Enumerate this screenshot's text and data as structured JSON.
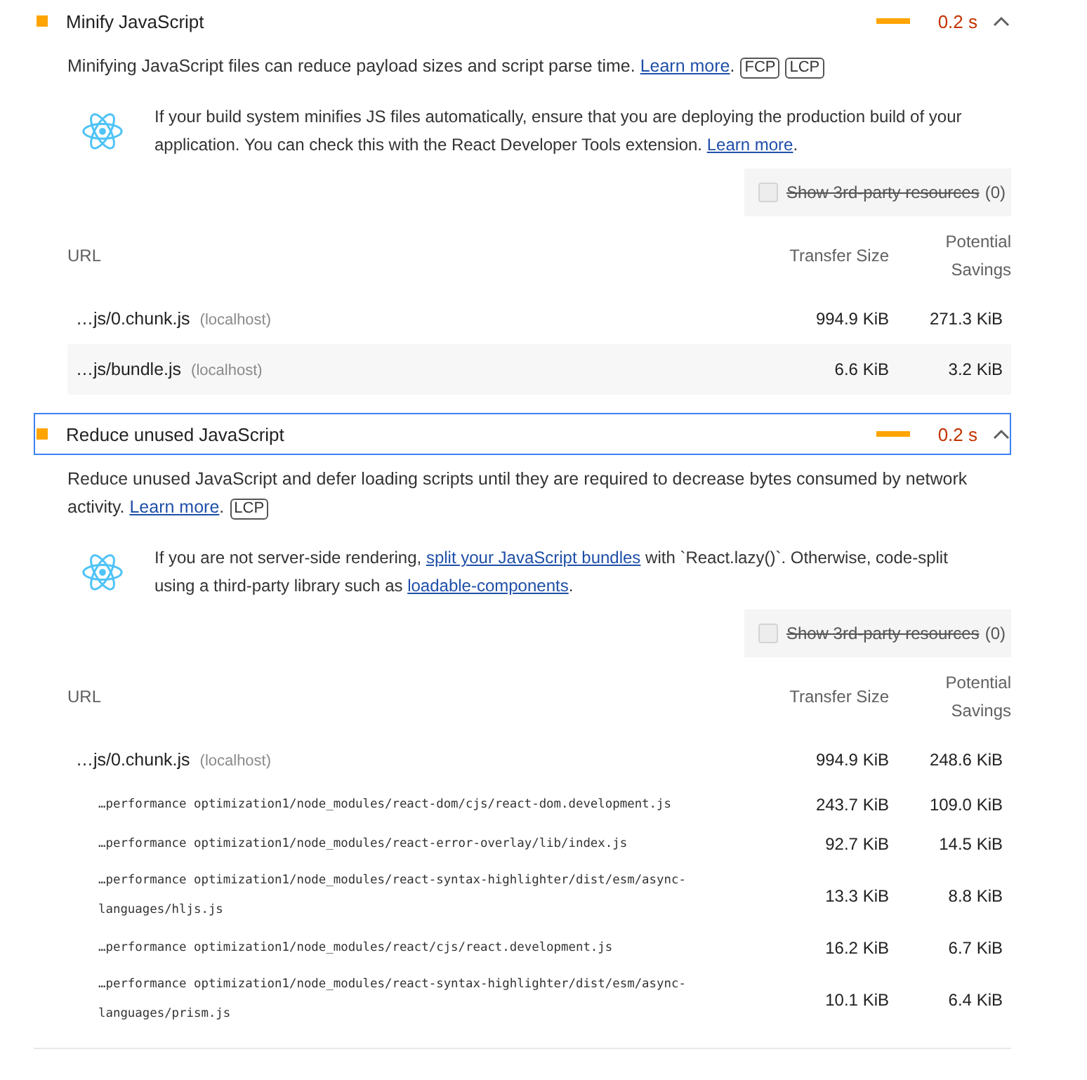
{
  "audits": [
    {
      "kind": "average",
      "title": "Minify JavaScript",
      "display_value": "0.2 s",
      "expanded": true,
      "focused": false,
      "description": [
        {
          "kind": "text",
          "text": "Minifying JavaScript files can reduce payload sizes and script parse time. "
        },
        {
          "kind": "link",
          "text": "Learn more"
        },
        {
          "kind": "text",
          "text": "."
        }
      ],
      "metrics": [
        "FCP",
        "LCP"
      ],
      "stack_pack": [
        {
          "kind": "text",
          "text": "If your build system minifies JS files automatically, ensure that you are deploying the production build of your application. You can check this with the React Developer Tools extension. "
        },
        {
          "kind": "link",
          "text": "Learn more"
        },
        {
          "kind": "text",
          "text": "."
        }
      ],
      "third_party_filter": {
        "label": "Show 3rd-party resources",
        "count": "(0)",
        "checked": false,
        "disabled": true
      },
      "table": {
        "columns": [
          "URL",
          "Transfer Size",
          "Potential Savings"
        ],
        "rows": [
          {
            "url": "…js/0.chunk.js",
            "host": "(localhost)",
            "transfer_size": "994.9 KiB",
            "savings": "271.3 KiB"
          },
          {
            "url": "…js/bundle.js",
            "host": "(localhost)",
            "transfer_size": "6.6 KiB",
            "savings": "3.2 KiB"
          }
        ]
      }
    },
    {
      "kind": "average",
      "title": "Reduce unused JavaScript",
      "display_value": "0.2 s",
      "expanded": true,
      "focused": true,
      "description": [
        {
          "kind": "text",
          "text": "Reduce unused JavaScript and defer loading scripts until they are required to decrease bytes consumed by network activity. "
        },
        {
          "kind": "link",
          "text": "Learn more"
        },
        {
          "kind": "text",
          "text": "."
        }
      ],
      "metrics": [
        "LCP"
      ],
      "stack_pack": [
        {
          "kind": "text",
          "text": "If you are not server-side rendering, "
        },
        {
          "kind": "link",
          "text": "split your JavaScript bundles"
        },
        {
          "kind": "text",
          "text": " with `React.lazy()`. Otherwise, code-split using a third-party library such as "
        },
        {
          "kind": "link",
          "text": "loadable-components"
        },
        {
          "kind": "text",
          "text": "."
        }
      ],
      "third_party_filter": {
        "label": "Show 3rd-party resources",
        "count": "(0)",
        "checked": false,
        "disabled": true
      },
      "table": {
        "columns": [
          "URL",
          "Transfer Size",
          "Potential Savings"
        ],
        "rows": [
          {
            "url": "…js/0.chunk.js",
            "host": "(localhost)",
            "transfer_size": "994.9 KiB",
            "savings": "248.6 KiB",
            "subitems": [
              {
                "url": "…performance optimization1/node_modules/react-dom/cjs/react-dom.development.js",
                "transfer_size": "243.7 KiB",
                "savings": "109.0 KiB"
              },
              {
                "url": "…performance optimization1/node_modules/react-error-overlay/lib/index.js",
                "transfer_size": "92.7 KiB",
                "savings": "14.5 KiB"
              },
              {
                "url": "…performance optimization1/node_modules/react-syntax-highlighter/dist/esm/async-languages/hljs.js",
                "transfer_size": "13.3 KiB",
                "savings": "8.8 KiB"
              },
              {
                "url": "…performance optimization1/node_modules/react/cjs/react.development.js",
                "transfer_size": "16.2 KiB",
                "savings": "6.7 KiB"
              },
              {
                "url": "…performance optimization1/node_modules/react-syntax-highlighter/dist/esm/async-languages/prism.js",
                "transfer_size": "10.1 KiB",
                "savings": "6.4 KiB"
              }
            ]
          }
        ]
      }
    }
  ]
}
